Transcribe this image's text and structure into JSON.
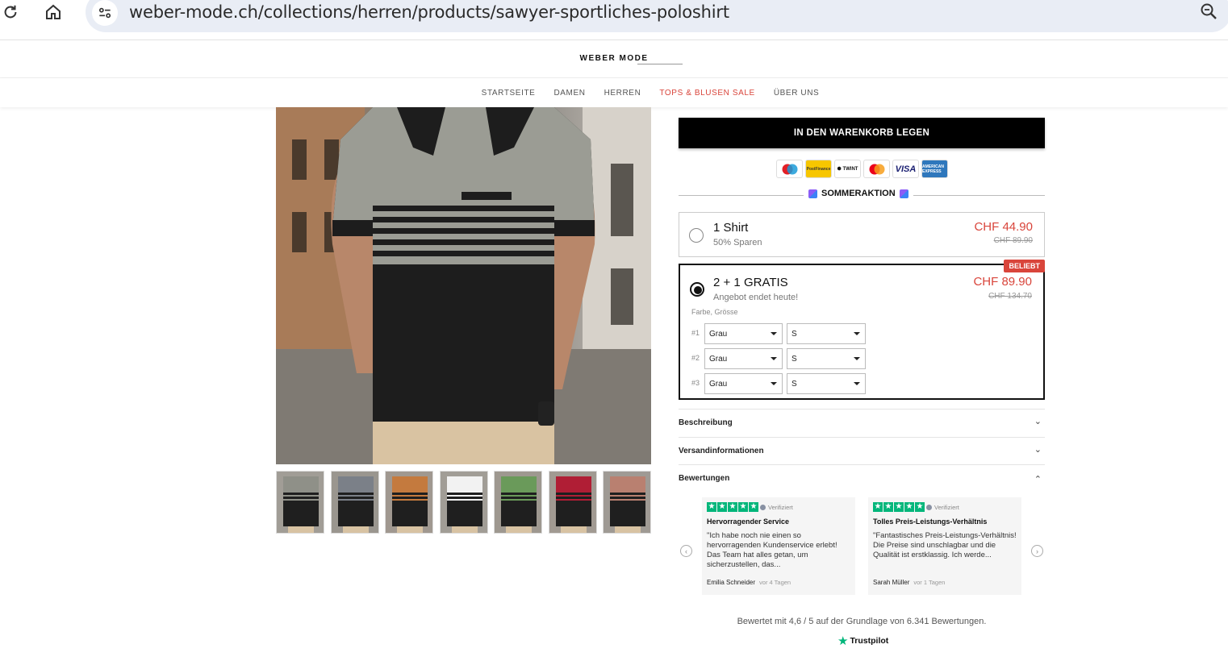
{
  "browser": {
    "url": "weber-mode.ch/collections/herren/products/sawyer-sportliches-poloshirt"
  },
  "site": {
    "logo": "WEBER MODE",
    "nav": [
      "STARTSEITE",
      "DAMEN",
      "HERREN",
      "TOPS & BLUSEN SALE",
      "ÜBER UNS"
    ]
  },
  "product": {
    "thumbnail_colors": [
      "#8f9088",
      "#7b8088",
      "#c47a3e",
      "#f2f2f2",
      "#6a9a5a",
      "#b01e35",
      "#b98070"
    ]
  },
  "buy": {
    "cart_button": "IN DEN WARENKORB LEGEN",
    "payments": [
      "Maestro",
      "PostFinance",
      "TWINT",
      "Mastercard",
      "VISA",
      "AMEX"
    ],
    "promo": "SOMMERAKTION"
  },
  "options": [
    {
      "title": "1 Shirt",
      "subtitle": "50% Sparen",
      "price": "CHF 44.90",
      "old_price": "CHF 89.90",
      "selected": false
    },
    {
      "title": "2 + 1 GRATIS",
      "subtitle": "Angebot endet heute!",
      "price": "CHF 89.90",
      "old_price": "CHF 134.70",
      "selected": true,
      "badge": "BELIEBT"
    }
  ],
  "variants": {
    "label": "Farbe, Grösse",
    "rows": [
      {
        "num": "#1",
        "color": "Grau",
        "size": "S"
      },
      {
        "num": "#2",
        "color": "Grau",
        "size": "S"
      },
      {
        "num": "#3",
        "color": "Grau",
        "size": "S"
      }
    ]
  },
  "accordion": [
    {
      "label": "Beschreibung",
      "chevron": "chevron-down"
    },
    {
      "label": "Versandinformationen",
      "chevron": "chevron-down"
    },
    {
      "label": "Bewertungen",
      "chevron": "chevron-up"
    }
  ],
  "reviews": [
    {
      "verified": "Verifiziert",
      "title": "Hervorragender Service",
      "text": "\"Ich habe noch nie einen so hervorragenden Kundenservice erlebt! Das Team hat alles getan, um sicherzustellen, das...",
      "author": "Emilia Schneider",
      "time": "vor 4 Tagen"
    },
    {
      "verified": "Verifiziert",
      "title": "Tolles Preis-Leistungs-Verhältnis",
      "text": "\"Fantastisches Preis-Leistungs-Verhältnis! Die Preise sind unschlagbar und die Qualität ist erstklassig. Ich werde...",
      "author": "Sarah Müller",
      "time": "vor 1 Tagen"
    }
  ],
  "rating_summary": "Bewertet mit 4,6 / 5 auf der Grundlage von 6.341 Bewertungen.",
  "trustpilot": "Trustpilot",
  "colors": {
    "accent": "#d9453b",
    "trustpilot": "#00b67a"
  }
}
